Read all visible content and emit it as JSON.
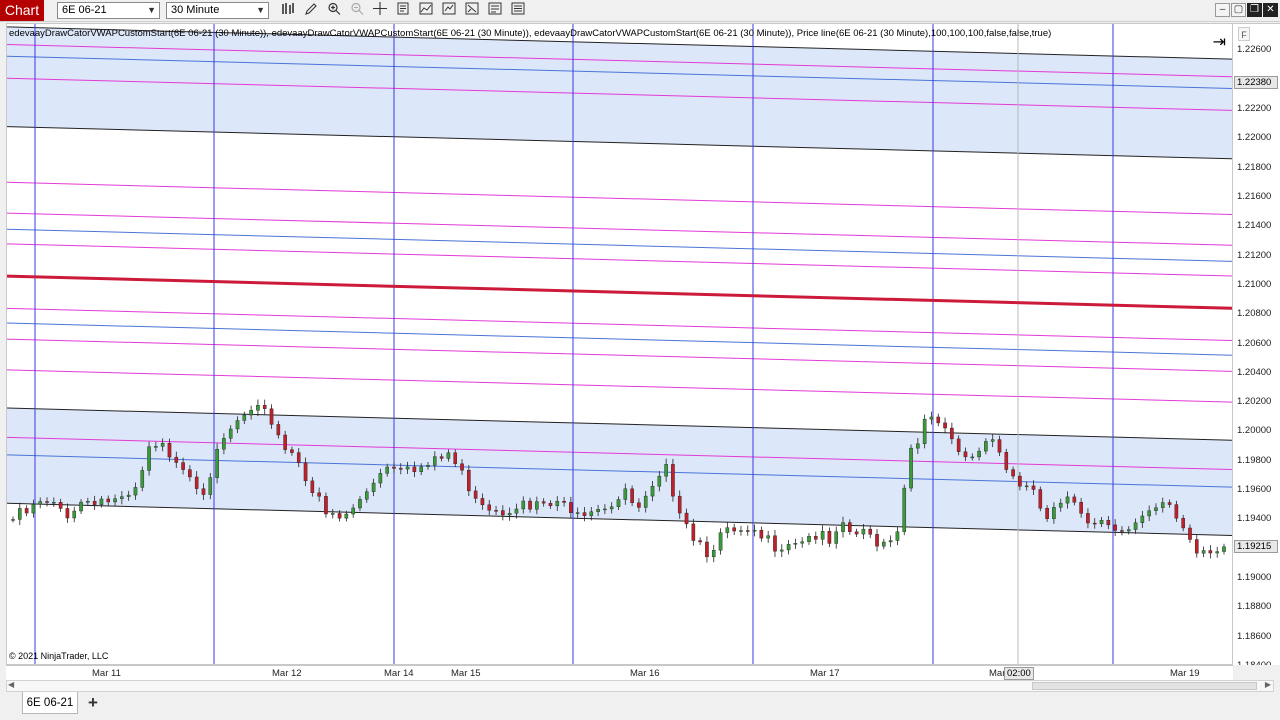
{
  "app_badge": "Chart",
  "toolbar": {
    "instrument": "6E 06-21",
    "interval": "30 Minute",
    "icons": [
      "bar-type-icon",
      "draw-tool-icon",
      "zoom-in-icon",
      "zoom-out-icon",
      "crosshair-icon",
      "data-box-icon",
      "indicators-icon",
      "strategies-icon",
      "properties-icon",
      "templates-icon",
      "instrument-link-icon"
    ]
  },
  "window_controls": [
    "minimize-icon",
    "maximize-icon",
    "restore-icon",
    "close-icon"
  ],
  "chart": {
    "indicator_label": "edevaayDrawCatorVWAPCustomStart(6E 06-21 (30 Minute)), edevaayDrawCatorVWAPCustomStart(6E 06-21 (30 Minute)), edevaayDrawCatorVWAPCustomStart(6E 06-21 (30 Minute)), Price line(6E 06-21 (30 Minute),100,100,100,false,false,true)",
    "copyright": "© 2021 NinjaTrader, LLC",
    "price_ticks": [
      "1.22600",
      "1.22200",
      "1.22000",
      "1.21800",
      "1.21600",
      "1.21400",
      "1.21200",
      "1.21000",
      "1.20800",
      "1.20600",
      "1.20400",
      "1.20200",
      "1.20000",
      "1.19800",
      "1.19600",
      "1.19400",
      "1.19000",
      "1.18800",
      "1.18600",
      "1.18400"
    ],
    "price_markers": {
      "upper_band": "1.22380",
      "last_price": "1.19215"
    },
    "time_ticks": [
      "Mar 11",
      "Mar 12",
      "Mar 14",
      "Mar 15",
      "Mar 16",
      "Mar 17",
      "Mar",
      "Mar 19"
    ],
    "time_marker": "02:00",
    "colors": {
      "vwap": "#cc1a3a",
      "band_fill": "#dde7fa",
      "band_pink": "#e23ad6",
      "band_blue": "#4a74d8",
      "band_edge": "#222222",
      "session_line": "#3a3ae0",
      "up_candle": "#3a9a3a",
      "down_candle": "#c0202a"
    }
  },
  "tabs": {
    "active": "6E 06-21",
    "add": "+"
  },
  "chart_data": {
    "type": "candlestick",
    "instrument": "6E 06-21",
    "interval": "30 Minute",
    "y_range": [
      1.184,
      1.2278
    ],
    "x_labels": [
      "Mar 11",
      "Mar 12",
      "Mar 14",
      "Mar 15",
      "Mar 16",
      "Mar 17",
      "Mar",
      "Mar 19"
    ],
    "vwap_start": 1.2106,
    "vwap_end": 1.2084,
    "last_price": 1.19215,
    "upper_band_marker": 1.2238,
    "close_path": [
      [
        0,
        1.194
      ],
      [
        2,
        1.1944
      ],
      [
        4,
        1.195
      ],
      [
        6,
        1.1948
      ],
      [
        8,
        1.1945
      ],
      [
        10,
        1.1952
      ],
      [
        12,
        1.1955
      ],
      [
        14,
        1.1953
      ],
      [
        16,
        1.195
      ],
      [
        18,
        1.1958
      ],
      [
        20,
        1.1985
      ],
      [
        22,
        1.1988
      ],
      [
        24,
        1.1984
      ],
      [
        26,
        1.1972
      ],
      [
        28,
        1.1962
      ],
      [
        30,
        1.1982
      ],
      [
        32,
        1.2
      ],
      [
        34,
        1.201
      ],
      [
        36,
        1.2012
      ],
      [
        38,
        1.2008
      ],
      [
        40,
        1.199
      ],
      [
        42,
        1.1982
      ],
      [
        44,
        1.196
      ],
      [
        46,
        1.1942
      ],
      [
        48,
        1.194
      ],
      [
        50,
        1.1946
      ],
      [
        52,
        1.196
      ],
      [
        54,
        1.1975
      ],
      [
        56,
        1.1978
      ],
      [
        58,
        1.198
      ],
      [
        60,
        1.1975
      ],
      [
        62,
        1.1978
      ],
      [
        64,
        1.1985
      ],
      [
        66,
        1.197
      ],
      [
        68,
        1.1958
      ],
      [
        70,
        1.195
      ],
      [
        72,
        1.1948
      ],
      [
        74,
        1.1952
      ],
      [
        76,
        1.1946
      ],
      [
        78,
        1.195
      ],
      [
        80,
        1.1948
      ],
      [
        82,
        1.195
      ],
      [
        84,
        1.1948
      ],
      [
        86,
        1.195
      ],
      [
        88,
        1.1952
      ],
      [
        90,
        1.1956
      ],
      [
        92,
        1.1945
      ],
      [
        94,
        1.1958
      ],
      [
        96,
        1.1972
      ],
      [
        98,
        1.195
      ],
      [
        100,
        1.193
      ],
      [
        102,
        1.192
      ],
      [
        104,
        1.1928
      ],
      [
        106,
        1.193
      ],
      [
        108,
        1.1928
      ],
      [
        110,
        1.1926
      ],
      [
        112,
        1.1924
      ],
      [
        114,
        1.1926
      ],
      [
        116,
        1.1928
      ],
      [
        118,
        1.193
      ],
      [
        120,
        1.1922
      ],
      [
        122,
        1.1932
      ],
      [
        124,
        1.193
      ],
      [
        126,
        1.1928
      ],
      [
        128,
        1.1925
      ],
      [
        130,
        1.1935
      ],
      [
        132,
        1.199
      ],
      [
        134,
        1.2005
      ],
      [
        136,
        1.2005
      ],
      [
        138,
        1.199
      ],
      [
        140,
        1.198
      ],
      [
        142,
        1.1988
      ],
      [
        144,
        1.2
      ],
      [
        146,
        1.1975
      ],
      [
        148,
        1.1965
      ],
      [
        150,
        1.1955
      ],
      [
        152,
        1.194
      ],
      [
        154,
        1.1948
      ],
      [
        156,
        1.1952
      ],
      [
        158,
        1.1942
      ],
      [
        160,
        1.194
      ],
      [
        162,
        1.1938
      ],
      [
        164,
        1.1932
      ],
      [
        166,
        1.1938
      ],
      [
        168,
        1.1945
      ],
      [
        170,
        1.195
      ],
      [
        172,
        1.1935
      ],
      [
        174,
        1.192
      ],
      [
        176,
        1.1922
      ],
      [
        178,
        1.19215
      ]
    ]
  }
}
